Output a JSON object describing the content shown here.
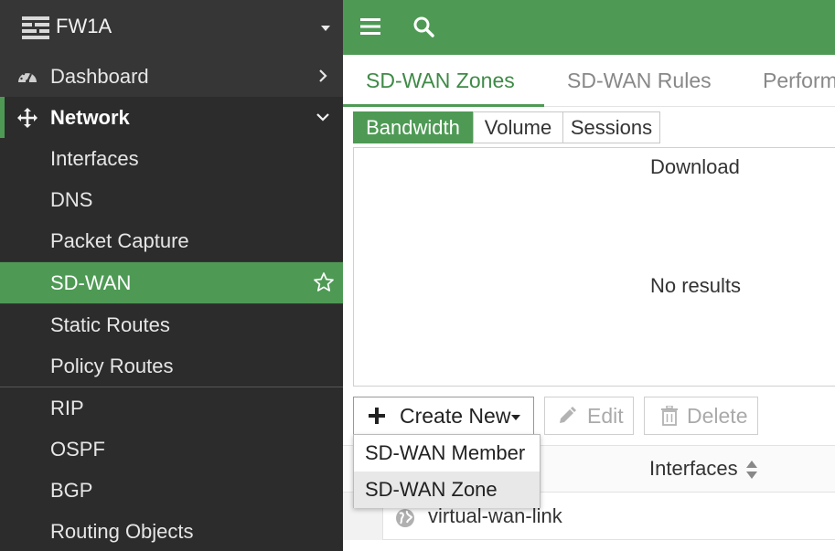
{
  "device": {
    "name": "FW1A",
    "icon": "fortigate-device-icon"
  },
  "sidebar": {
    "items": [
      {
        "label": "Dashboard",
        "icon": "dashboard-icon"
      },
      {
        "label": "Network",
        "icon": "network-move-icon"
      },
      {
        "label": "Interfaces"
      },
      {
        "label": "DNS"
      },
      {
        "label": "Packet Capture"
      },
      {
        "label": "SD-WAN",
        "selected": true
      },
      {
        "label": "Static Routes"
      },
      {
        "label": "Policy Routes"
      },
      {
        "label": "RIP"
      },
      {
        "label": "OSPF"
      },
      {
        "label": "BGP"
      },
      {
        "label": "Routing Objects"
      }
    ]
  },
  "tabs": [
    {
      "label": "SD-WAN Zones",
      "active": true
    },
    {
      "label": "SD-WAN Rules"
    },
    {
      "label": "Perform"
    }
  ],
  "segments": [
    {
      "label": "Bandwidth",
      "active": true
    },
    {
      "label": "Volume"
    },
    {
      "label": "Sessions"
    }
  ],
  "chart_panel": {
    "title": "Download",
    "empty_text": "No results"
  },
  "toolbar": {
    "create_label": "Create New",
    "edit_label": "Edit",
    "delete_label": "Delete"
  },
  "dropdown": {
    "items": [
      {
        "label": "SD-WAN Member"
      },
      {
        "label": "SD-WAN Zone",
        "highlighted": true
      }
    ]
  },
  "table": {
    "columns": [
      "Interfaces"
    ],
    "rows": [
      {
        "name": "virtual-wan-link"
      }
    ]
  },
  "colors": {
    "accent": "#4e9a55",
    "sidebar_bg": "#363636",
    "sidebar_sub_bg": "#2c2c2c"
  }
}
